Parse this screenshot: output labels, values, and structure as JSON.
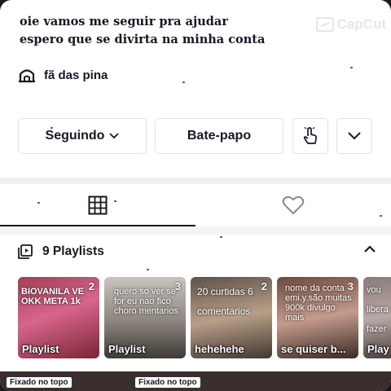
{
  "profile": {
    "bio_line1": "oie vamos me seguir pra ajudar",
    "bio_line2": "espero que se divirta na minha conta",
    "link_text": "fã das pina",
    "link_icon": "house-icon"
  },
  "watermark": {
    "text": "CapCut"
  },
  "actions": {
    "follow_label": "Seguindo",
    "chat_label": "Bate-papo",
    "share_icon": "hand-pointer-icon",
    "more_icon": "chevron-down-icon"
  },
  "tabs": [
    {
      "name": "videos",
      "icon": "grid-icon",
      "active": true
    },
    {
      "name": "liked",
      "icon": "heart-icon",
      "active": false
    }
  ],
  "playlists": {
    "title": "9 Playlists",
    "items": [
      {
        "label": "Playlist",
        "count": "2",
        "overlay": "BIOVANILA VE OKK META 1k"
      },
      {
        "label": "Playlist",
        "count": "3",
        "overlay": "quero so ver se for eu nao fico choro mentarios"
      },
      {
        "label": "hehehehe",
        "count": "2",
        "overlay": "20 curtidas 6 comentarios"
      },
      {
        "label": "se quiser b...",
        "count": "3",
        "overlay": "nome da conta emi.y.são muitas 900k divulgo mais"
      },
      {
        "label": "Play",
        "count": "",
        "overlay": "vou libera fazer"
      }
    ]
  },
  "pinned": {
    "label1": "Fixado no topo",
    "label2": "Fixado no topo"
  }
}
